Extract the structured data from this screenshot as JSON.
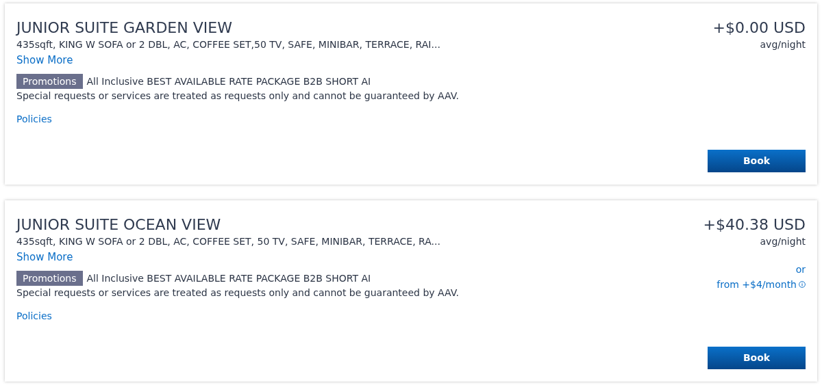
{
  "rooms": [
    {
      "title": "JUNIOR SUITE GARDEN VIEW",
      "details": "435sqft, KING W SOFA or 2 DBL, AC, COFFEE SET,50 TV, SAFE, MINIBAR, TERRACE, RAI...",
      "show_more": "Show More",
      "promo_badge": "Promotions",
      "promo_text": "All Inclusive BEST AVAILABLE RATE PACKAGE B2B SHORT AI",
      "note": "Special requests or services are treated as requests only and cannot be guaranteed by AAV.",
      "policies": "Policies",
      "price": "+$0.00 USD",
      "price_unit": "avg/night",
      "book": "Book"
    },
    {
      "title": "JUNIOR SUITE OCEAN VIEW",
      "details": "435sqft, KING W SOFA or 2 DBL, AC, COFFEE SET, 50 TV, SAFE, MINIBAR, TERRACE, RA...",
      "show_more": "Show More",
      "promo_badge": "Promotions",
      "promo_text": "All Inclusive BEST AVAILABLE RATE PACKAGE B2B SHORT AI",
      "note": "Special requests or services are treated as requests only and cannot be guaranteed by AAV.",
      "policies": "Policies",
      "price": "+$40.38 USD",
      "price_unit": "avg/night",
      "financing": {
        "or": "or",
        "text": "from +$4/month"
      },
      "book": "Book"
    }
  ]
}
